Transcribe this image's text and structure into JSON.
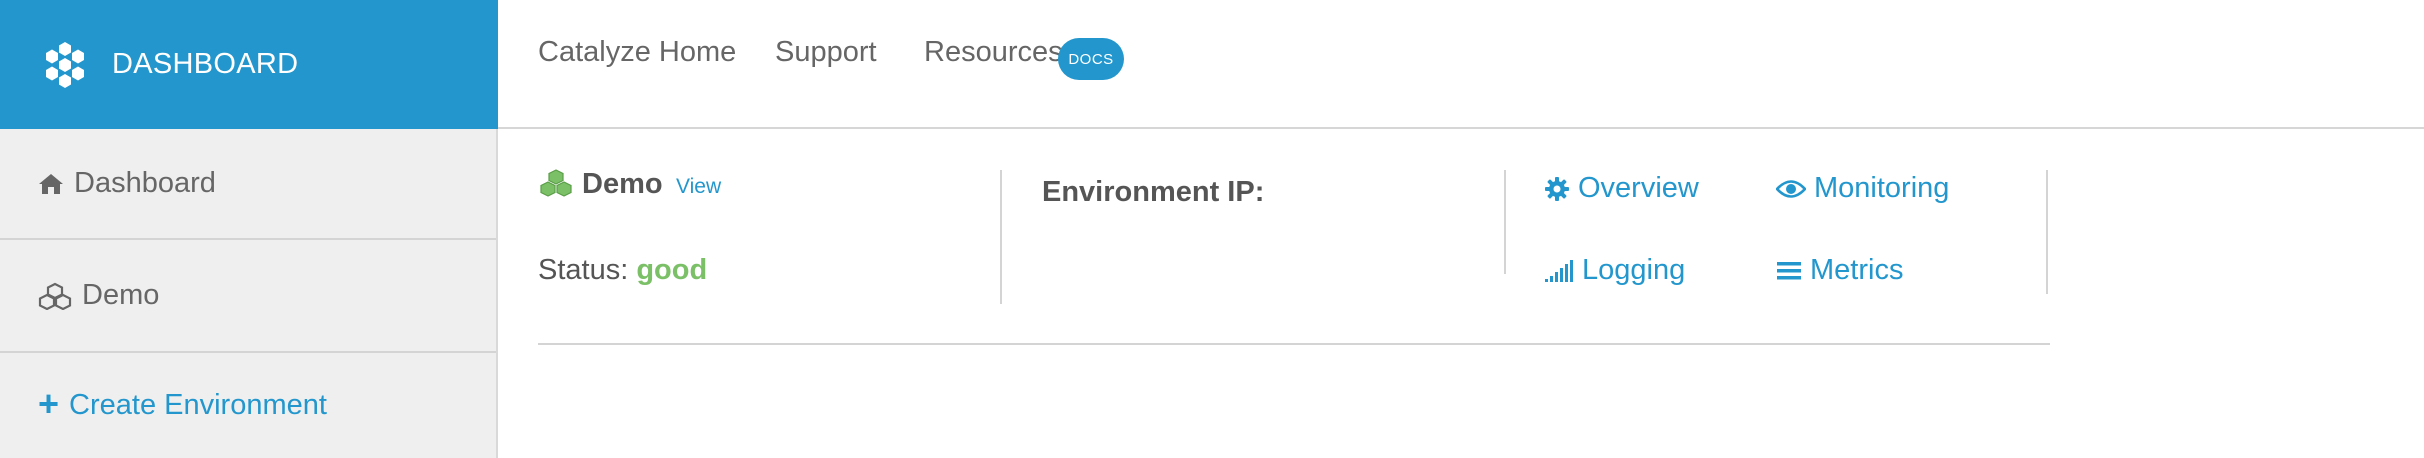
{
  "brand": {
    "title": "DASHBOARD",
    "logo_icon": "hexagon-cluster-icon",
    "color": "#2397cd"
  },
  "sidebar": {
    "items": [
      {
        "label": "Dashboard",
        "icon": "home-icon"
      },
      {
        "label": "Demo",
        "icon": "cubes-icon"
      },
      {
        "label": "Create Environment",
        "icon": "plus-icon"
      }
    ]
  },
  "topnav": {
    "links": [
      {
        "label": "Catalyze Home"
      },
      {
        "label": "Support"
      },
      {
        "label": "Resources"
      }
    ],
    "docs_badge": "DOCS"
  },
  "environment": {
    "name": "Demo",
    "icon": "cubes-icon",
    "view_label": "View",
    "status_label": "Status:",
    "status_value": "good",
    "status_color": "#7bc067",
    "ip_label": "Environment IP:",
    "ip_value": "",
    "links": [
      {
        "label": "Overview",
        "icon": "gear-icon"
      },
      {
        "label": "Monitoring",
        "icon": "eye-icon"
      },
      {
        "label": "Logging",
        "icon": "signal-bars-icon"
      },
      {
        "label": "Metrics",
        "icon": "list-icon"
      }
    ]
  },
  "colors": {
    "accent": "#2397cd",
    "sidebar_bg": "#efefef",
    "text": "#555555"
  }
}
